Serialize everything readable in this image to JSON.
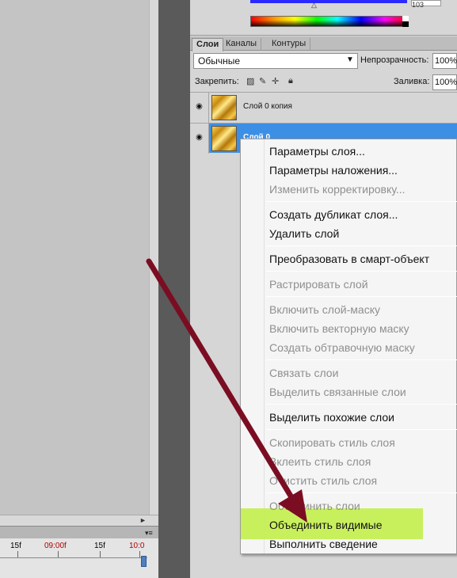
{
  "colors": {
    "canvas": "#c4c4c4",
    "panel": "#d6d6d6",
    "selection": "#3d8fe6",
    "highlight": "#c5ef54",
    "annotation_arrow": "#7b0d22"
  },
  "swatch": {
    "value": "103"
  },
  "panel_tabs": [
    {
      "label": "Слои",
      "active": true
    },
    {
      "label": "Каналы",
      "active": false
    },
    {
      "label": "Контуры",
      "active": false
    }
  ],
  "layers_panel": {
    "blend_mode": "Обычные",
    "opacity_label": "Непрозрачность:",
    "opacity_value": "100%",
    "lock_label": "Закрепить:",
    "fill_label": "Заливка:",
    "fill_value": "100%",
    "lock_icons": [
      "lock-transparency-icon",
      "lock-paint-icon",
      "lock-position-icon",
      "lock-all-icon"
    ]
  },
  "layers": [
    {
      "name": "Слой 0 копия",
      "selected": false,
      "visible": true
    },
    {
      "name": "Слой 0",
      "selected": true,
      "visible": true
    }
  ],
  "context_menu": {
    "items": [
      {
        "label": "Параметры слоя...",
        "enabled": true
      },
      {
        "label": "Параметры наложения...",
        "enabled": true
      },
      {
        "label": "Изменить корректировку...",
        "enabled": false
      },
      {
        "label": "Создать дубликат слоя...",
        "enabled": true
      },
      {
        "label": "Удалить слой",
        "enabled": true
      },
      {
        "label": "Преобразовать в смарт-объект",
        "enabled": true
      },
      {
        "label": "Растрировать слой",
        "enabled": false
      },
      {
        "label": "Включить слой-маску",
        "enabled": false
      },
      {
        "label": "Включить векторную маску",
        "enabled": false
      },
      {
        "label": "Создать обтравочную маску",
        "enabled": false
      },
      {
        "label": "Связать слои",
        "enabled": false
      },
      {
        "label": "Выделить связанные слои",
        "enabled": false
      },
      {
        "label": "Выделить похожие слои",
        "enabled": true
      },
      {
        "label": "Скопировать стиль слоя",
        "enabled": false
      },
      {
        "label": "Вклеить стиль слоя",
        "enabled": false
      },
      {
        "label": "Очистить стиль слоя",
        "enabled": false
      },
      {
        "label": "Объединить слои",
        "enabled": false
      },
      {
        "label": "Объединить видимые",
        "enabled": true,
        "highlighted": true
      },
      {
        "label": "Выполнить сведение",
        "enabled": true
      }
    ]
  },
  "timeline": {
    "ticks": [
      {
        "label": "15f",
        "color": "#111111"
      },
      {
        "label": "09:00f",
        "color": "#b00000"
      },
      {
        "label": "15f",
        "color": "#111111"
      },
      {
        "label": "10:0",
        "color": "#b00000"
      }
    ]
  }
}
